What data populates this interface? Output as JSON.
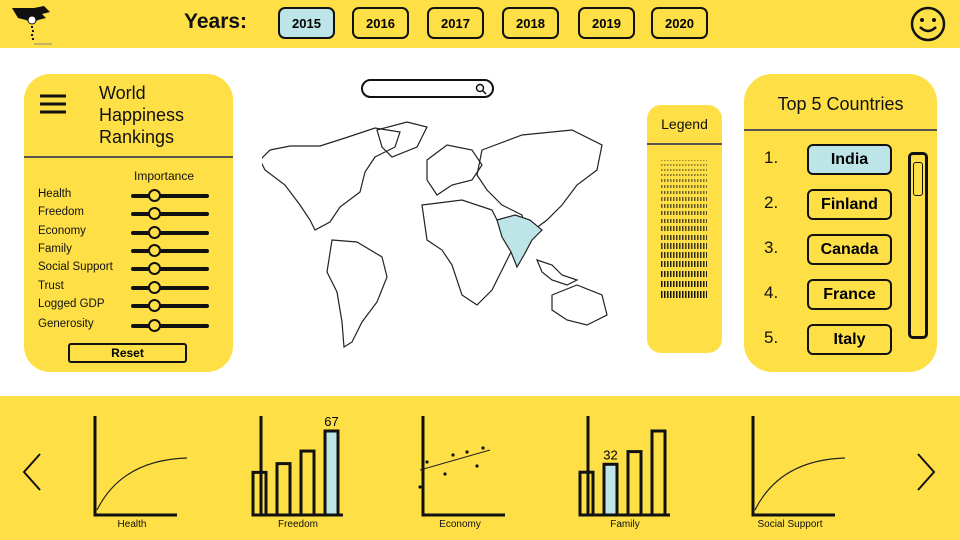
{
  "header": {
    "years_label": "Years:",
    "years": [
      "2015",
      "2016",
      "2017",
      "2018",
      "2019",
      "2020"
    ],
    "selected_year": "2015",
    "logo_icon": "hand-dropping-icon",
    "user_icon": "smiley-face-icon"
  },
  "sidebar": {
    "title_lines": [
      "World",
      "Happiness",
      "Rankings"
    ],
    "importance_label": "Importance",
    "factors": [
      {
        "label": "Health",
        "value": 0.3
      },
      {
        "label": "Freedom",
        "value": 0.3
      },
      {
        "label": "Economy",
        "value": 0.3
      },
      {
        "label": "Family",
        "value": 0.3
      },
      {
        "label": "Social Support",
        "value": 0.3
      },
      {
        "label": "Trust",
        "value": 0.3
      },
      {
        "label": "Logged GDP",
        "value": 0.3
      },
      {
        "label": "Generosity",
        "value": 0.3
      }
    ],
    "reset_label": "Reset"
  },
  "map": {
    "search_placeholder": "",
    "highlighted_country": "India",
    "highlight_color": "#BDE5E8"
  },
  "legend": {
    "title": "Legend"
  },
  "top5": {
    "title": "Top 5 Countries",
    "ranks": [
      "1.",
      "2.",
      "3.",
      "4.",
      "5."
    ],
    "countries": [
      "India",
      "Finland",
      "Canada",
      "France",
      "Italy"
    ],
    "selected": "India"
  },
  "colors": {
    "panel": "#FEE046",
    "accent": "#BDE5E8"
  },
  "chart_data": [
    {
      "type": "line",
      "xlabel": "Health",
      "shape": "increasing-concave"
    },
    {
      "type": "bar",
      "xlabel": "Freedom",
      "values": [
        34,
        41,
        51,
        67
      ],
      "highlight_index": 3,
      "data_label": "67"
    },
    {
      "type": "scatter",
      "xlabel": "Economy",
      "trend": "increasing"
    },
    {
      "type": "bar",
      "xlabel": "Family",
      "values": [
        27,
        32,
        40,
        53
      ],
      "highlight_index": 1,
      "data_label": "32"
    },
    {
      "type": "line",
      "xlabel": "Social Support",
      "shape": "increasing-concave"
    }
  ]
}
